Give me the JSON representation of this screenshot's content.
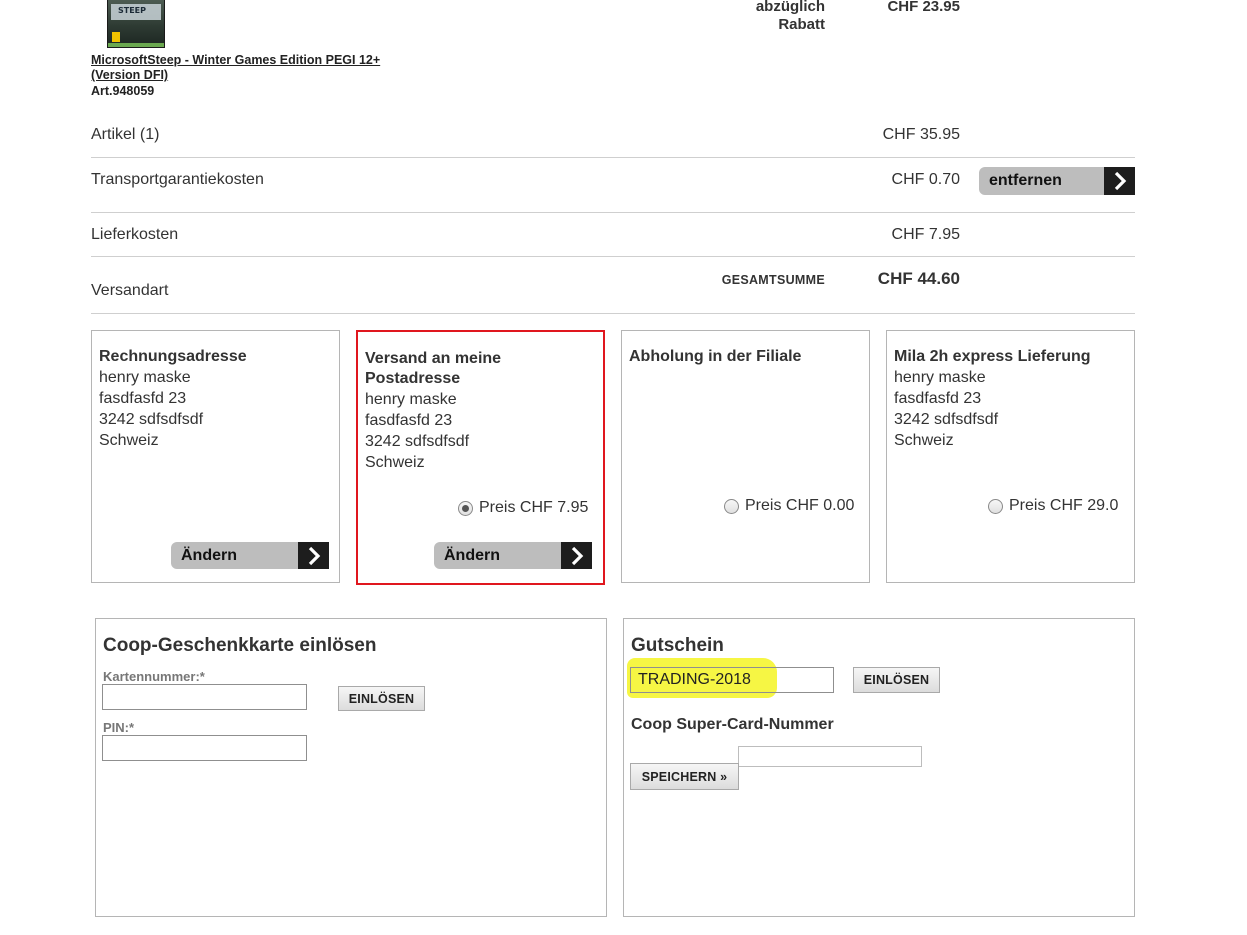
{
  "product": {
    "name": "MicrosoftSteep - Winter Games Edition PEGI 12+ (Version DFI)",
    "article": "Art.948059",
    "thumb_word": "STEEP"
  },
  "discount": {
    "label_line1": "abzüglich",
    "label_line2": "Rabatt",
    "value": "CHF 23.95"
  },
  "summary": {
    "articles_label": "Artikel (1)",
    "articles_value": "CHF 35.95",
    "transport_label": "Transportgarantiekosten",
    "transport_value": "CHF 0.70",
    "remove_button": "entfernen",
    "delivery_label": "Lieferkosten",
    "delivery_value": "CHF 7.95",
    "shipping_label": "Versandart",
    "total_label": "GESAMTSUMME",
    "total_value": "CHF 44.60"
  },
  "shipping": {
    "billing": {
      "title": "Rechnungsadresse",
      "name": "henry maske",
      "street": "fasdfasfd 23",
      "city": "3242 sdfsdfsdf",
      "country": "Schweiz",
      "button": "Ändern"
    },
    "postal": {
      "title_line1": "Versand an meine",
      "title_line2": "Postadresse",
      "name": "henry maske",
      "street": "fasdfasfd 23",
      "city": "3242 sdfsdfsdf",
      "country": "Schweiz",
      "price": "Preis CHF 7.95",
      "selected": true,
      "button": "Ändern"
    },
    "pickup": {
      "title": "Abholung in der Filiale",
      "price": "Preis CHF 0.00",
      "selected": false
    },
    "express": {
      "title": "Mila 2h express Lieferung",
      "name": "henry maske",
      "street": "fasdfasfd 23",
      "city": "3242 sdfsdfsdf",
      "country": "Schweiz",
      "price": "Preis CHF 29.0",
      "selected": false
    }
  },
  "giftcard": {
    "title": "Coop-Geschenkkarte einlösen",
    "card_label": "Kartennummer:*",
    "card_value": "",
    "pin_label": "PIN:*",
    "pin_value": "",
    "redeem_button": "EINLÖSEN"
  },
  "voucher": {
    "title": "Gutschein",
    "code_value": "TRADING-2018",
    "redeem_button": "EINLÖSEN",
    "supercard_label": "Coop Super-Card-Nummer",
    "supercard_value": "",
    "save_button": "SPEICHERN »"
  },
  "colors": {
    "selected_border": "#e0171e",
    "highlight": "#f5f53a",
    "button_grey": "#bdbdbd",
    "button_arrow": "#1d1d1d"
  },
  "icons": {
    "arrow": "chevron-right-icon"
  }
}
